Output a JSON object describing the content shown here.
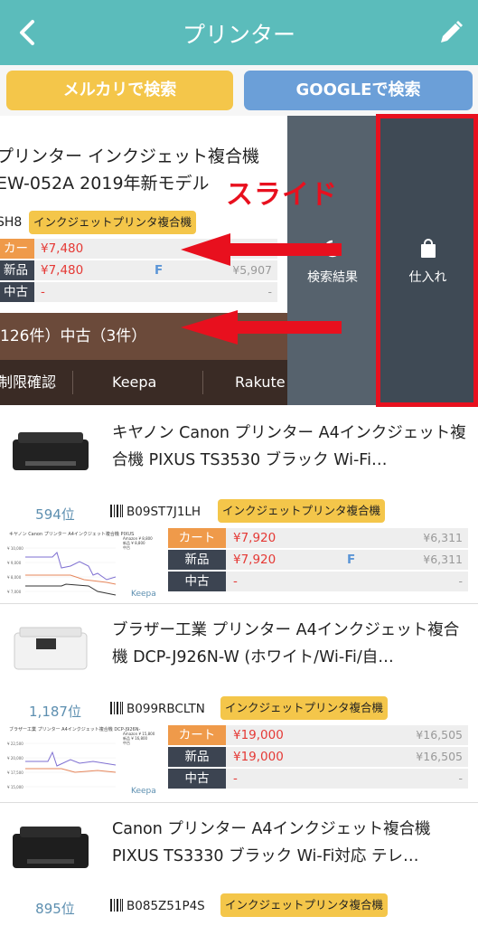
{
  "header": {
    "title": "プリンター"
  },
  "search": {
    "mercari_label": "メルカリで検索",
    "google_label": "GOOGLEで検索"
  },
  "slid_item": {
    "title_line1": "プリンター インクジェット複合機",
    "title_line2": "EW-052A 2019年新モデル",
    "asin_fragment": "SH8",
    "category": "インクジェットプリンタ複合機",
    "prices": [
      {
        "label": "カート",
        "price": "¥7,480",
        "ref": "¥5,907"
      },
      {
        "label": "新品",
        "price": "¥7,480",
        "flag": "F",
        "ref": "¥5,907"
      },
      {
        "label": "中古",
        "price": "-",
        "ref": "-"
      }
    ],
    "offers_text": "126件）中古（3件）",
    "links": [
      "制限確認",
      "Keepa",
      "Rakute"
    ],
    "action_search_label": "検索結果",
    "action_buy_label": "仕入れ",
    "annotation": "スライド"
  },
  "products": [
    {
      "name": "キヤノン Canon プリンター A4インクジェット複合機 PIXUS TS3530 ブラック Wi-Fi…",
      "rank": "594位",
      "asin": "B09ST7J1LH",
      "category": "インクジェットプリンタ複合機",
      "cart_price": "¥7,920",
      "cart_ref": "¥6,311",
      "new_price": "¥7,920",
      "new_flag": "F",
      "new_ref": "¥6,311",
      "used_price": "-",
      "used_ref": "-",
      "chart_caption": "キヤノン Canon プリンター A4インクジェット複合機 PIXUS",
      "chart_legend": [
        "Amazon ¥ 8,800",
        "新品 ¥ 8,800",
        "中古"
      ],
      "chart_yticks": [
        "¥ 10,000",
        "¥ 9,000",
        "¥ 8,000",
        "¥ 7,000"
      ],
      "keepa": "Keepa"
    },
    {
      "name": "ブラザー工業 プリンター A4インクジェット複合機 DCP-J926N-W (ホワイト/Wi-Fi/自…",
      "rank": "1,187位",
      "asin": "B099RBCLTN",
      "category": "インクジェットプリンタ複合機",
      "cart_price": "¥19,000",
      "cart_ref": "¥16,505",
      "new_price": "¥19,000",
      "new_ref": "¥16,505",
      "used_price": "-",
      "used_ref": "-",
      "chart_caption": "ブラザー工業 プリンター A4インクジェット複合機 DCP-J926N-",
      "chart_legend": [
        "Amazon ¥ 15,800",
        "新品 ¥ 16,800",
        "中古"
      ],
      "chart_yticks": [
        "¥ 22,500",
        "¥ 20,000",
        "¥ 17,500",
        "¥ 15,000"
      ],
      "keepa": "Keepa"
    },
    {
      "name": "Canon プリンター A4インクジェット複合機 PIXUS TS3330 ブラック Wi-Fi対応 テレ…",
      "rank": "895位",
      "asin": "B085Z51P4S",
      "category": "インクジェットプリンタ複合機"
    }
  ]
}
